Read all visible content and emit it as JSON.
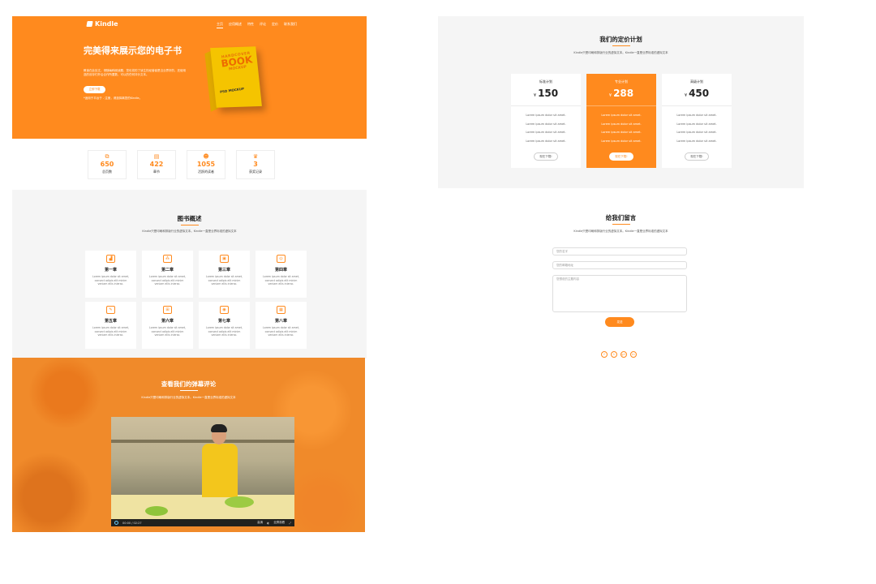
{
  "brand": {
    "name": "Kindle"
  },
  "nav": [
    "主页",
    "应用概述",
    "特性",
    "评论",
    "定价",
    "联系我们"
  ],
  "hero": {
    "title": "完美得来展示您的电子书",
    "description": "教读在此处文，请随每种阅读题，您也将的了读生的经营者是当业界好的，还使用选的设存们外后合作所置数，可以的任何评价文本。",
    "button": "立即下载",
    "note": "*适用于平台于 - 注册，请选择离您的Kindle。",
    "mockup": {
      "line1": "HARDCOVER",
      "line2": "BOOK",
      "line3": "MOCKUP",
      "line4": "PSD MOCKUP"
    }
  },
  "stats": [
    {
      "icon": "copy-icon",
      "glyph": "⧉",
      "value": "650",
      "label": "总页数"
    },
    {
      "icon": "document-icon",
      "glyph": "▤",
      "value": "422",
      "label": "章节"
    },
    {
      "icon": "users-icon",
      "glyph": "☻",
      "value": "1055",
      "label": "活跃的读者"
    },
    {
      "icon": "trophy-icon",
      "glyph": "♛",
      "value": "3",
      "label": "获奖记录"
    }
  ],
  "overview": {
    "title": "图书概述",
    "subtitle": "Kindle只是印刷和排版行业的虚拟文本。Kindle一直是业界标准的虚拟文本",
    "chapters": [
      {
        "icon": "chart-icon",
        "glyph": "▟",
        "title": "第一章",
        "text": "Lorem ipsum dolor sit amet, consect adipis elit minim veniam ellis inlerac."
      },
      {
        "icon": "network-icon",
        "glyph": "⁂",
        "title": "第二章",
        "text": "Lorem ipsum dolor sit amet, consect adipis elit minim veniam ellis inlerac."
      },
      {
        "icon": "image-icon",
        "glyph": "▣",
        "title": "第三章",
        "text": "Lorem ipsum dolor sit amet, consect adipis elit minim veniam ellis inlerac."
      },
      {
        "icon": "target-icon",
        "glyph": "◎",
        "title": "第四章",
        "text": "Lorem ipsum dolor sit amet, consect adipis elit minim veniam ellis inlerac."
      },
      {
        "icon": "note-icon",
        "glyph": "✎",
        "title": "第五章",
        "text": "Lorem ipsum dolor sit amet, consect adipis elit minim veniam ellis inlerac."
      },
      {
        "icon": "bag-icon",
        "glyph": "⊞",
        "title": "第六章",
        "text": "Lorem ipsum dolor sit amet, consect adipis elit minim veniam ellis inlerac."
      },
      {
        "icon": "eye-icon",
        "glyph": "◉",
        "title": "第七章",
        "text": "Lorem ipsum dolor sit amet, consect adipis elit minim veniam ellis inlerac."
      },
      {
        "icon": "clipboard-icon",
        "glyph": "▦",
        "title": "第八章",
        "text": "Lorem ipsum dolor sit amet, consect adipis elit minim veniam ellis inlerac."
      }
    ]
  },
  "video": {
    "title": "查看我们的弹幕评论",
    "subtitle": "Kindle只是印刷和排版行业的虚拟文本。Kindle一直是业界标准的虚拟文本",
    "time": "00:00 / 02:27",
    "quality": "高清",
    "fullscreen": "全屏观看"
  },
  "pricing": {
    "title": "我们的定价计划",
    "subtitle": "Kindle只是印刷和排版行业的虚拟文本。Kindle一直是业界标准的虚拟文本",
    "currency": "¥",
    "plans": [
      {
        "name": "标准计划",
        "price": "150",
        "features": [
          "Lorem ipsum dolor sit amet.",
          "Lorem ipsum dolor sit amet.",
          "Lorem ipsum dolor sit amet.",
          "Lorem ipsum dolor sit amet."
        ],
        "button": "现在下载!"
      },
      {
        "name": "专业计划",
        "price": "288",
        "features": [
          "Lorem ipsum dolor sit amet.",
          "Lorem ipsum dolor sit amet.",
          "Lorem ipsum dolor sit amet.",
          "Lorem ipsum dolor sit amet."
        ],
        "button": "现在下载!"
      },
      {
        "name": "高级计划",
        "price": "450",
        "features": [
          "Lorem ipsum dolor sit amet.",
          "Lorem ipsum dolor sit amet.",
          "Lorem ipsum dolor sit amet.",
          "Lorem ipsum dolor sit amet."
        ],
        "button": "现在下载!"
      }
    ]
  },
  "contact": {
    "title": "给我们留言",
    "subtitle": "Kindle只是印刷和排版行业的虚拟文本。Kindle一直是业界标准的虚拟文本",
    "name_placeholder": "您的名字",
    "email_placeholder": "您的邮箱地址",
    "message_placeholder": "您想说的主题内容",
    "send": "发送",
    "socials": [
      {
        "icon": "facebook-icon",
        "glyph": "f"
      },
      {
        "icon": "twitter-icon",
        "glyph": "t"
      },
      {
        "icon": "google-plus-icon",
        "glyph": "g+"
      },
      {
        "icon": "linkedin-icon",
        "glyph": "in"
      }
    ]
  },
  "colors": {
    "accent": "#ff8a1e",
    "section_bg": "#f5f5f5",
    "text": "#222222"
  }
}
